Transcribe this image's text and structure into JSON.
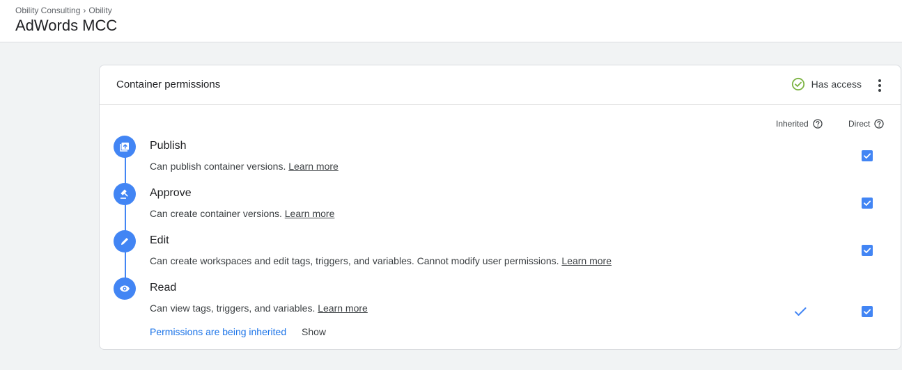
{
  "header": {
    "breadcrumb": [
      "Obility Consulting",
      "Obility"
    ],
    "breadcrumb_separator": "›",
    "title": "AdWords MCC"
  },
  "card": {
    "title": "Container permissions",
    "access_label": "Has access",
    "access_icon": "check-circle-icon",
    "access_color": "#7cb342",
    "columns": {
      "inherited": "Inherited",
      "direct": "Direct"
    }
  },
  "permissions": [
    {
      "name": "Publish",
      "icon": "publish-icon",
      "description": "Can publish container versions.",
      "link": "Learn more",
      "inherited": false,
      "direct": true
    },
    {
      "name": "Approve",
      "icon": "gavel-icon",
      "description": "Can create container versions.",
      "link": "Learn more",
      "inherited": false,
      "direct": true
    },
    {
      "name": "Edit",
      "icon": "pencil-icon",
      "description": "Can create workspaces and edit tags, triggers, and variables. Cannot modify user permissions.",
      "link": "Learn more",
      "inherited": false,
      "direct": true
    },
    {
      "name": "Read",
      "icon": "eye-icon",
      "description": "Can view tags, triggers, and variables.",
      "link": "Learn more",
      "inherited": true,
      "direct": true
    }
  ],
  "footer": {
    "inherit_note": "Permissions are being inherited",
    "show_label": "Show"
  },
  "colors": {
    "accent": "#4285f4",
    "link_blue": "#1a73e8"
  }
}
